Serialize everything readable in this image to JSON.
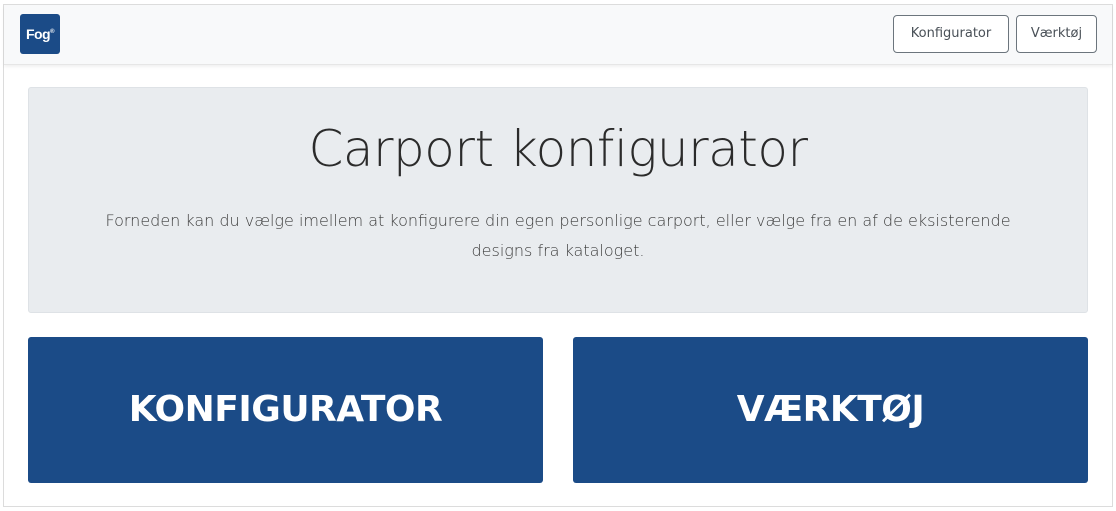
{
  "brand": {
    "logo_text": "Fog",
    "logo_mark": "®",
    "color": "#1b4b87"
  },
  "navbar": {
    "configurator_label": "Konfigurator",
    "tools_label": "Værktøj"
  },
  "hero": {
    "title": "Carport konfigurator",
    "description": "Forneden kan du vælge imellem at konfigurere din egen personlige carport, eller vælge fra en af de eksisterende designs fra kataloget."
  },
  "actions": {
    "configurator_label": "KONFIGURATOR",
    "tools_label": "VÆRKTØJ"
  }
}
